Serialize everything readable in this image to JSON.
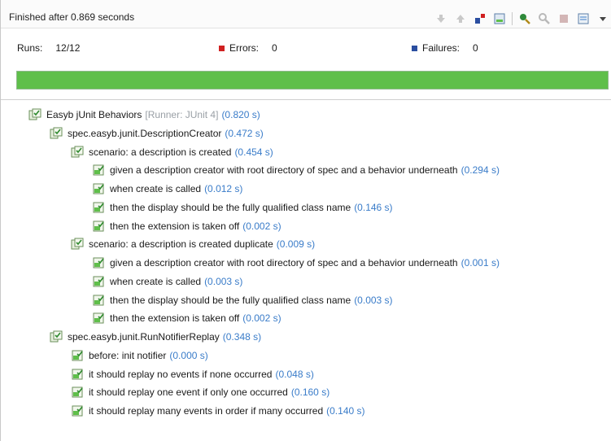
{
  "status": {
    "text": "Finished after 0.869 seconds"
  },
  "toolbar": {
    "icons": [
      "next-failure-icon",
      "previous-failure-icon",
      "show-failures-only-icon",
      "scroll-lock-icon",
      "rerun-icon",
      "rerun-failed-first-icon",
      "stop-icon",
      "history-icon",
      "view-menu-icon"
    ]
  },
  "counters": {
    "runs_label": "Runs:",
    "runs_value": "12/12",
    "errors_label": "Errors:",
    "errors_value": "0",
    "failures_label": "Failures:",
    "failures_value": "0"
  },
  "progress": {
    "fraction": 1.0,
    "color": "#5fbf4a"
  },
  "colors": {
    "time": "#3a7cc9",
    "runner": "#9aa0a6",
    "error": "#d02020",
    "failure": "#2b4ea0"
  },
  "tree": {
    "rows": [
      {
        "kind": "suite",
        "name": "Easyb jUnit Behaviors",
        "runner": "[Runner: JUnit 4]",
        "time": "(0.820 s)"
      },
      {
        "kind": "suite",
        "name": "spec.easyb.junit.DescriptionCreator",
        "time": "(0.472 s)"
      },
      {
        "kind": "suite",
        "name": "scenario: a description is created",
        "time": "(0.454 s)"
      },
      {
        "kind": "test",
        "name": "given a description creator with root directory of spec and a behavior underneath",
        "time": "(0.294 s)"
      },
      {
        "kind": "test",
        "name": "when create is called",
        "time": "(0.012 s)"
      },
      {
        "kind": "test",
        "name": "then the display should be the fully qualified class name",
        "time": "(0.146 s)"
      },
      {
        "kind": "test",
        "name": "then the extension is taken off",
        "time": "(0.002 s)"
      },
      {
        "kind": "suite",
        "name": "scenario: a description is created duplicate",
        "time": "(0.009 s)"
      },
      {
        "kind": "test",
        "name": "given a description creator with root directory of spec and a behavior underneath",
        "time": "(0.001 s)"
      },
      {
        "kind": "test",
        "name": "when create is called",
        "time": "(0.003 s)"
      },
      {
        "kind": "test",
        "name": "then the display should be the fully qualified class name",
        "time": "(0.003 s)"
      },
      {
        "kind": "test",
        "name": "then the extension is taken off",
        "time": "(0.002 s)"
      },
      {
        "kind": "suite",
        "name": "spec.easyb.junit.RunNotifierReplay",
        "time": "(0.348 s)"
      },
      {
        "kind": "test",
        "name": "before: init notifier",
        "time": "(0.000 s)"
      },
      {
        "kind": "test",
        "name": "it should replay no events if none occurred",
        "time": "(0.048 s)"
      },
      {
        "kind": "test",
        "name": "it should replay one event if only one occurred",
        "time": "(0.160 s)"
      },
      {
        "kind": "test",
        "name": "it should replay many events in order if many occurred",
        "time": "(0.140 s)"
      }
    ]
  }
}
